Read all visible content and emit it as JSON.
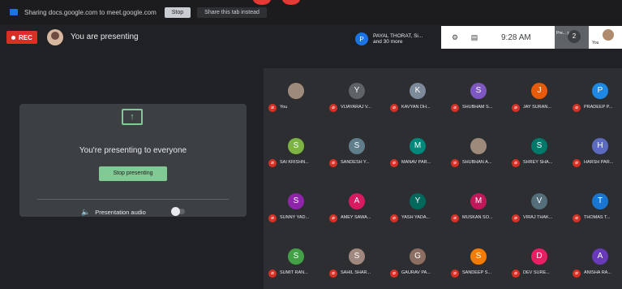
{
  "share_bar": {
    "message": "Sharing docs.google.com to meet.google.com",
    "stop_label": "Stop",
    "share_tab_label": "Share this tab instead"
  },
  "meet_top": {
    "rec_label": "REC",
    "presenting_label": "You are presenting",
    "pinned_line1": "PAYAL THORAT, Si...",
    "pinned_line2": "and 30 more",
    "pinned_initial": "P",
    "time": "9:28 AM",
    "chip_text": "Pre... you...",
    "chip_icon": "2",
    "you_label": "You"
  },
  "presentation": {
    "title": "You're presenting to everyone",
    "stop_label": "Stop presenting",
    "audio_label": "Presentation audio"
  },
  "participants": [
    {
      "initial": "",
      "name": "You",
      "color": "#9e8a7a",
      "photo": true
    },
    {
      "initial": "Y",
      "name": "VIJAYARAJ V...",
      "color": "#5f6368"
    },
    {
      "initial": "K",
      "name": "KAVYAN DH...",
      "color": "#7c8a99"
    },
    {
      "initial": "S",
      "name": "SHUBHAM S...",
      "color": "#7e57c2"
    },
    {
      "initial": "J",
      "name": "JAY SURAN...",
      "color": "#e8590c"
    },
    {
      "initial": "P",
      "name": "PRADEEP P...",
      "color": "#1e88e5"
    },
    {
      "initial": "S",
      "name": "SAI KRISHN...",
      "color": "#7cb342"
    },
    {
      "initial": "S",
      "name": "SANDESH Y...",
      "color": "#607d8b"
    },
    {
      "initial": "M",
      "name": "MANAV PAR...",
      "color": "#00897b"
    },
    {
      "initial": "",
      "name": "SHUBHAN A...",
      "color": "#6d5a4c",
      "photo": true
    },
    {
      "initial": "S",
      "name": "SHREY SHA...",
      "color": "#00796b"
    },
    {
      "initial": "H",
      "name": "HARSH PAR...",
      "color": "#5c6bc0"
    },
    {
      "initial": "S",
      "name": "SUNNY YAD...",
      "color": "#8e24aa"
    },
    {
      "initial": "A",
      "name": "AMEY SAWA...",
      "color": "#d81b60"
    },
    {
      "initial": "Y",
      "name": "YASH YADA...",
      "color": "#00695c"
    },
    {
      "initial": "M",
      "name": "MUSKAN SO...",
      "color": "#c2185b"
    },
    {
      "initial": "V",
      "name": "VIRAJ THAK...",
      "color": "#546e7a"
    },
    {
      "initial": "T",
      "name": "THOMAS T...",
      "color": "#1976d2"
    },
    {
      "initial": "S",
      "name": "SUMIT RAN...",
      "color": "#43a047"
    },
    {
      "initial": "S",
      "name": "SAHIL SHAR...",
      "color": "#a1887f"
    },
    {
      "initial": "G",
      "name": "GAURAV PA...",
      "color": "#8d6e63"
    },
    {
      "initial": "S",
      "name": "SANDEEP S...",
      "color": "#f57c00"
    },
    {
      "initial": "D",
      "name": "DEV SURE...",
      "color": "#e91e63"
    },
    {
      "initial": "A",
      "name": "ANISHA RA...",
      "color": "#673ab7"
    }
  ]
}
